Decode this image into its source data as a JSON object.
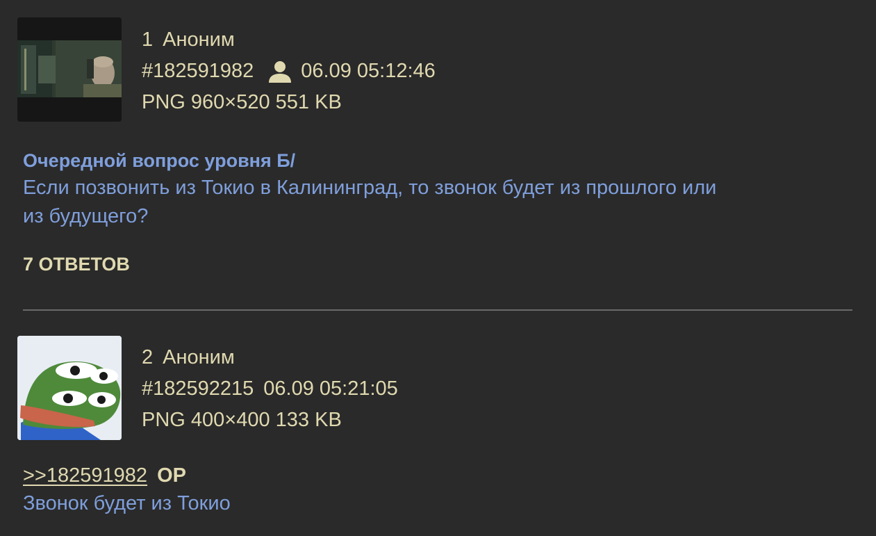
{
  "posts": [
    {
      "number": "1",
      "author": "Аноним",
      "post_id": "#182591982",
      "datetime": "06.09 05:12:46",
      "file_info": "PNG 960×520 551 KB",
      "thumb_icon": "soldier-photo-thumbnail",
      "subject": "Очередной вопрос уровня Б/",
      "body_lines": [
        "Если позвонить из Токио в Калининград, то звонок будет из прошлого или",
        "из будущего?"
      ],
      "replies_label": "7 ОТВЕТОВ"
    },
    {
      "number": "2",
      "author": "Аноним",
      "post_id": "#182592215",
      "datetime": "06.09 05:21:05",
      "file_info": "PNG 400×400 133 KB",
      "thumb_icon": "pepe-frog-thumbnail",
      "reply_link": ">>182591982",
      "op_badge": "OP",
      "body_lines": [
        "Звонок будет из Токио"
      ]
    }
  ],
  "colors": {
    "background": "#2a2a2a",
    "meta_text": "#e0d9b0",
    "post_text": "#7f9fdc",
    "divider": "#6a6a6a"
  },
  "icons": {
    "op_marker": "user-icon"
  }
}
